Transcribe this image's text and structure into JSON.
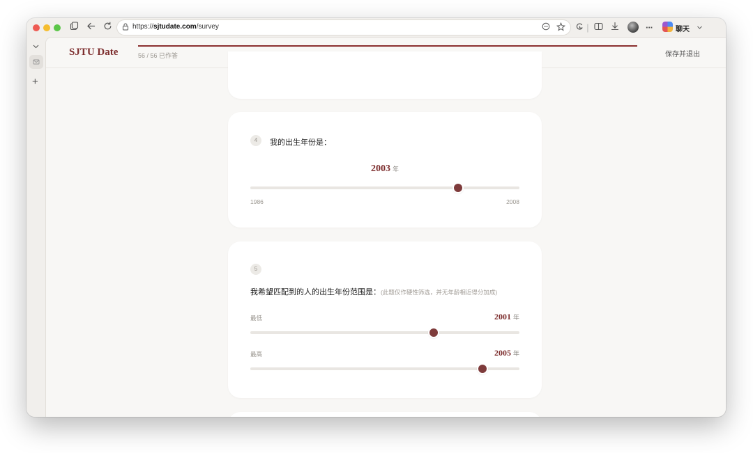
{
  "browser": {
    "url_prefix": "https://",
    "url_domain": "sjtudate.com",
    "url_path": "/survey",
    "chat_label": "聊天"
  },
  "header": {
    "logo": "SJTU Date",
    "progress_text": "56 / 56 已作答",
    "progress_fraction": 1.0,
    "save_exit": "保存并退出"
  },
  "q4": {
    "number": "4",
    "question": "我的出生年份是：",
    "value": "2003",
    "unit": "年",
    "min_label": "1986",
    "max_label": "2008",
    "min": 1986,
    "max": 2008,
    "selected": 2003
  },
  "q5": {
    "number": "5",
    "question": "我希望匹配到的人的出生年份范围是：",
    "hint": "(此题仅作硬性筛选，并无年龄相近得分加成)",
    "low_label": "最低",
    "low_value": "2001",
    "high_label": "最高",
    "high_value": "2005",
    "unit": "年",
    "min": 1986,
    "max": 2008,
    "low_selected": 2001,
    "high_selected": 2005
  },
  "colors": {
    "accent": "#7e2f2f",
    "thumb": "#7e3b3b",
    "track": "#e9e6e2"
  }
}
